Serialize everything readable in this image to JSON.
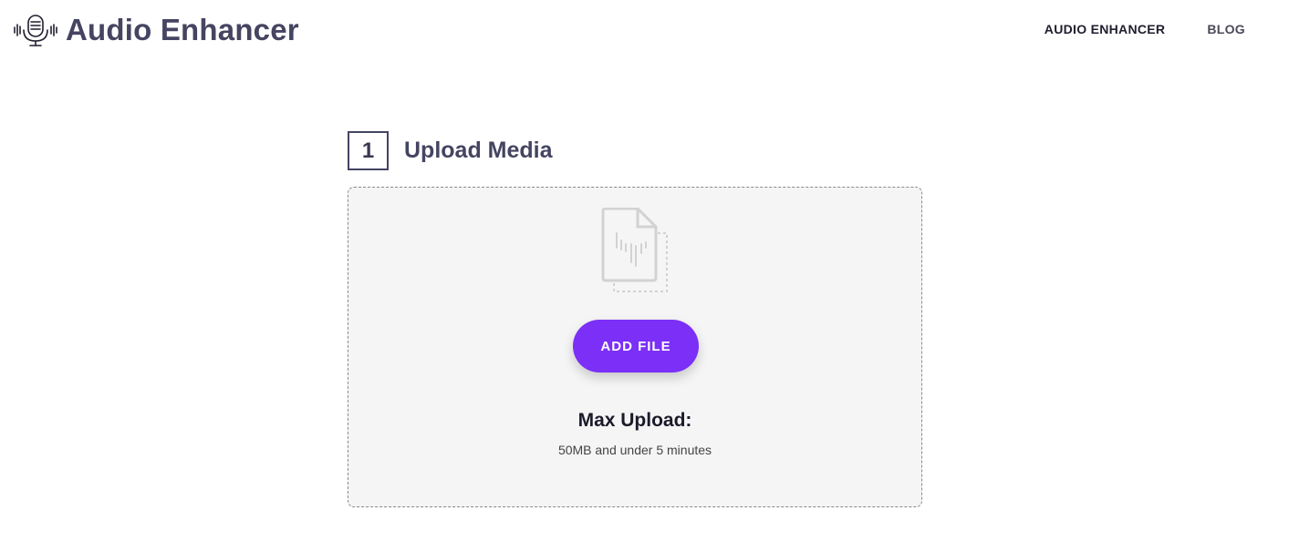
{
  "header": {
    "logo_text": "Audio Enhancer",
    "logo_icon": "microphone-waveform-icon",
    "nav": {
      "audio_enhancer": "AUDIO ENHANCER",
      "blog": "BLOG"
    }
  },
  "upload": {
    "step_number": "1",
    "step_title": "Upload Media",
    "file_icon": "audio-file-icon",
    "add_file_label": "ADD FILE",
    "max_title": "Max Upload:",
    "max_subtitle": "50MB and under 5 minutes"
  },
  "colors": {
    "accent": "#7b2ff7",
    "heading": "#454461",
    "dropzone_bg": "#f5f5f5"
  }
}
